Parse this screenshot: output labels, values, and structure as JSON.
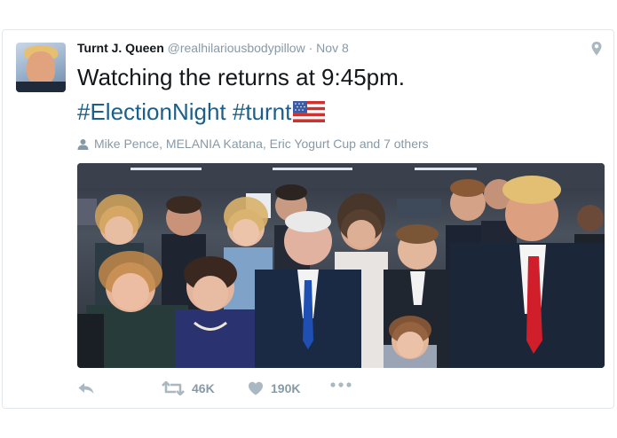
{
  "tweet": {
    "name": "Turnt J. Queen",
    "handle": "@realhilariousbodypillow",
    "separator": "·",
    "date": "Nov 8",
    "text": "Watching the returns at 9:45pm.",
    "hashtags": "#ElectionNight #turnt",
    "tagged": "Mike Pence, MELANIA Katana, Eric Yogurt Cup and 7 others"
  },
  "actions": {
    "retweets": "46K",
    "likes": "190K"
  },
  "icons": {
    "location": "map-pin-icon",
    "tag": "person-icon",
    "reply": "reply-icon",
    "retweet": "retweet-icon",
    "like": "heart-icon",
    "more": "more-icon"
  },
  "colors": {
    "link": "#1b5f8a",
    "text": "#14171a",
    "meta": "#8899a6"
  }
}
